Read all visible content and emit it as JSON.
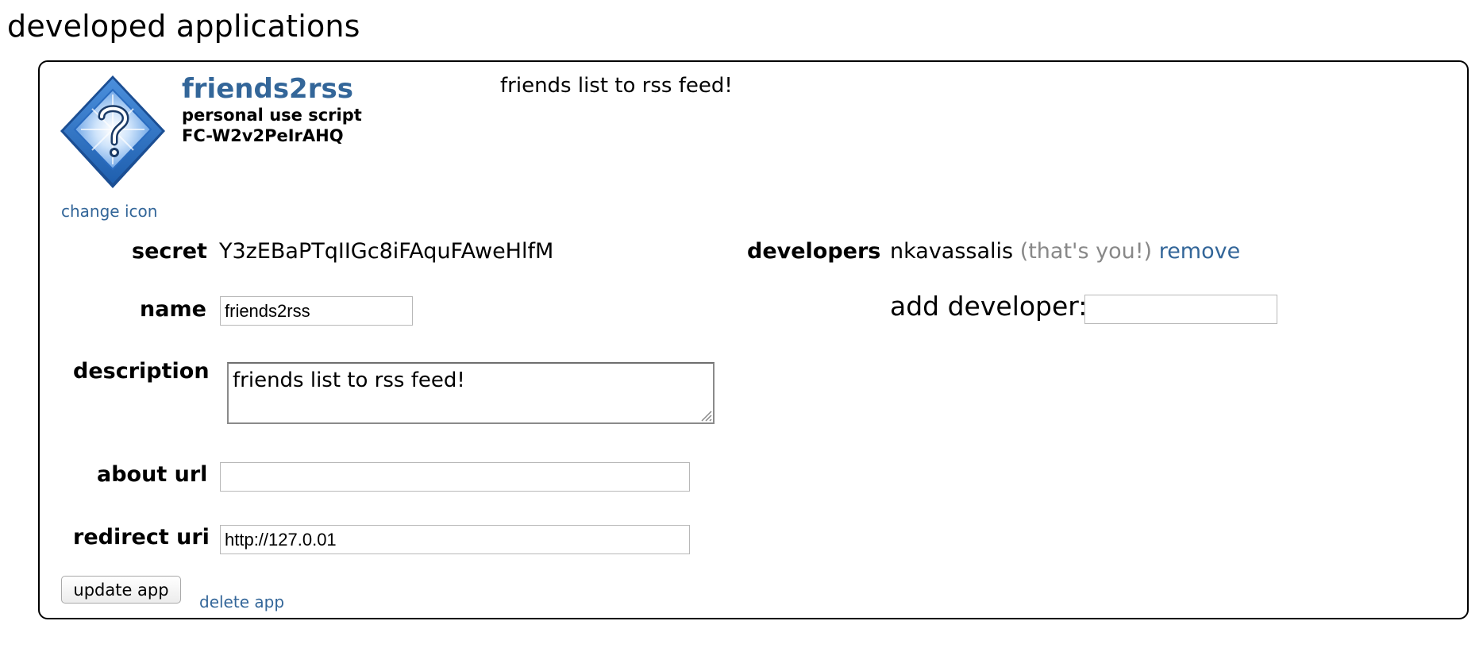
{
  "page": {
    "title": "developed applications"
  },
  "app": {
    "name": "friends2rss",
    "type": "personal use script",
    "id": "FC-W2v2PeIrAHQ",
    "description_preview": "friends list to rss feed!",
    "change_icon_label": "change icon",
    "icon": "question-mark-diamond-icon"
  },
  "fields": {
    "secret_label": "secret",
    "secret_value": "Y3zEBaPTqIIGc8iFAquFAweHlfM",
    "name_label": "name",
    "name_value": "friends2rss",
    "description_label": "description",
    "description_value": "friends list to rss feed!",
    "about_url_label": "about url",
    "about_url_value": "",
    "redirect_uri_label": "redirect uri",
    "redirect_uri_value": "http://127.0.01"
  },
  "developers": {
    "label": "developers",
    "name": "nkavassalis",
    "note": "(that's you!)",
    "remove_label": "remove",
    "add_label": "add developer:",
    "add_value": ""
  },
  "actions": {
    "update_label": "update app",
    "delete_label": "delete app"
  },
  "colors": {
    "link": "#336699",
    "muted": "#888888",
    "icon_blue": "#3a7fd0"
  }
}
